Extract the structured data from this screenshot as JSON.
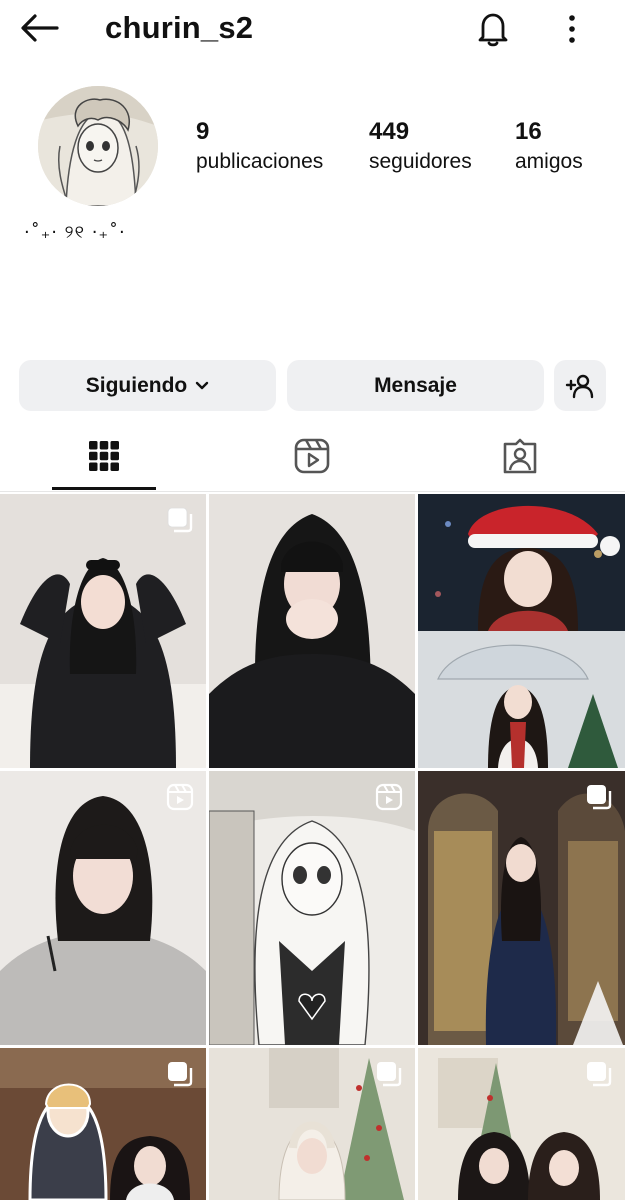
{
  "header": {
    "username": "churin_s2"
  },
  "profile": {
    "stats": [
      {
        "value": "9",
        "label": "publicaciones"
      },
      {
        "value": "449",
        "label": "seguidores"
      },
      {
        "value": "16",
        "label": "amigos"
      }
    ],
    "bio": "·˚₊· ୨୧ ·₊˚·"
  },
  "actions": {
    "following_label": "Siguiendo",
    "message_label": "Mensaje"
  },
  "tabs": [
    {
      "name": "grid",
      "icon": "grid-icon",
      "active": true
    },
    {
      "name": "reels",
      "icon": "reels-icon",
      "active": false
    },
    {
      "name": "tagged",
      "icon": "tagged-icon",
      "active": false
    }
  ],
  "grid_posts": [
    {
      "type": "carousel",
      "icon": "carousel-icon"
    },
    {
      "type": "photo"
    },
    {
      "type": "photo"
    },
    {
      "type": "reel",
      "icon": "reel-icon"
    },
    {
      "type": "reel",
      "icon": "reel-icon"
    },
    {
      "type": "carousel",
      "icon": "carousel-icon"
    },
    {
      "type": "carousel",
      "icon": "carousel-icon"
    },
    {
      "type": "carousel",
      "icon": "carousel-icon"
    },
    {
      "type": "carousel",
      "icon": "carousel-icon"
    }
  ],
  "colors": {
    "button_bg": "#eff0f2",
    "text": "#111111"
  }
}
